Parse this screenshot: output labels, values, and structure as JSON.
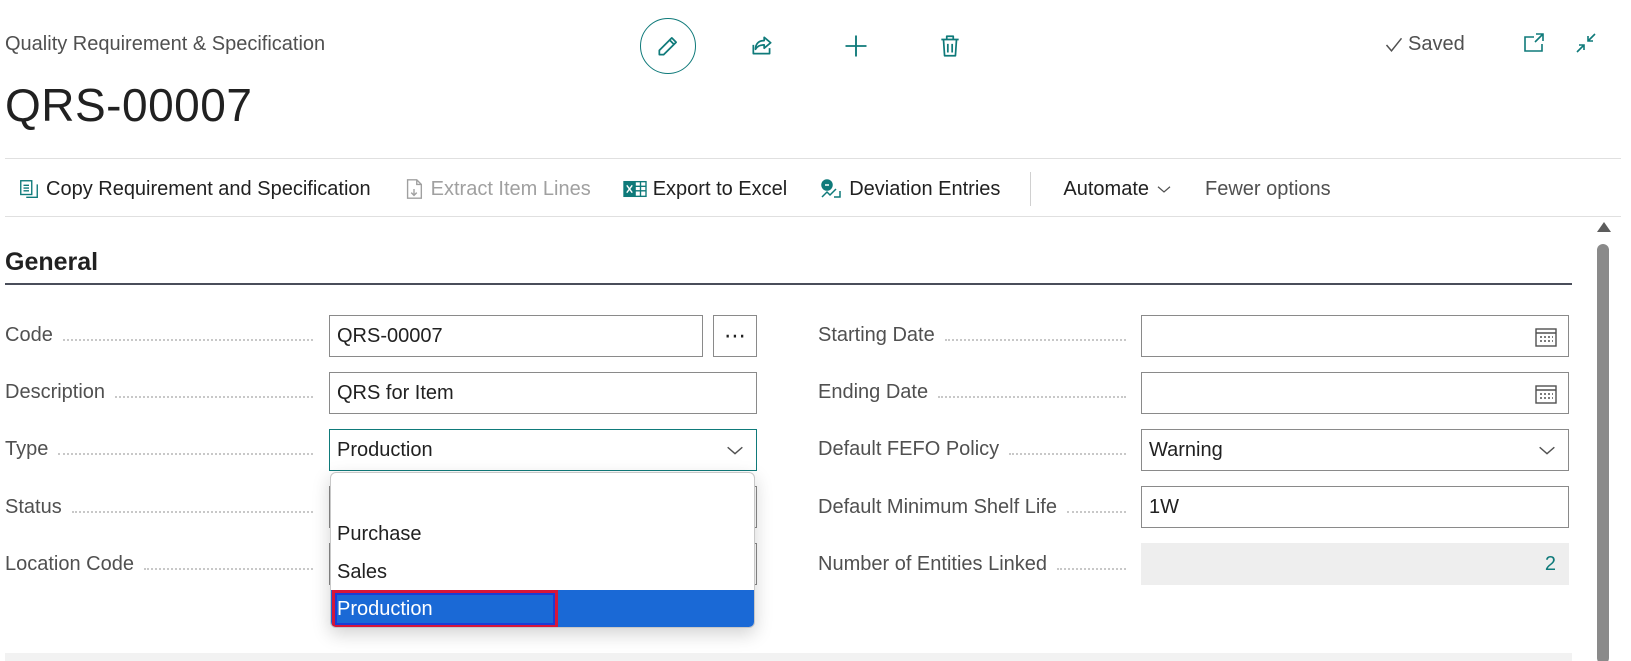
{
  "header": {
    "caption": "Quality Requirement & Specification",
    "title": "QRS-00007",
    "saved_label": "Saved"
  },
  "toolbar": {
    "copy_label": "Copy Requirement and Specification",
    "extract_label": "Extract Item Lines",
    "export_label": "Export to Excel",
    "deviation_label": "Deviation Entries",
    "automate_label": "Automate",
    "fewer_label": "Fewer options"
  },
  "section": {
    "title": "General"
  },
  "fields": {
    "code": {
      "label": "Code",
      "value": "QRS-00007"
    },
    "description": {
      "label": "Description",
      "value": "QRS for Item"
    },
    "type": {
      "label": "Type",
      "value": "Production"
    },
    "status": {
      "label": "Status"
    },
    "location_code": {
      "label": "Location Code"
    },
    "starting_date": {
      "label": "Starting Date",
      "value": ""
    },
    "ending_date": {
      "label": "Ending Date",
      "value": ""
    },
    "fefo_policy": {
      "label": "Default FEFO Policy",
      "value": "Warning"
    },
    "min_shelf_life": {
      "label": "Default Minimum Shelf Life",
      "value": "1W"
    },
    "entities_linked": {
      "label": "Number of Entities Linked",
      "value": "2"
    }
  },
  "type_dropdown": {
    "options": [
      "",
      "Purchase",
      "Sales",
      "Production"
    ],
    "selected": "Production"
  },
  "colors": {
    "accent": "#0f7a7a",
    "selection": "#1a69d6",
    "highlight_border": "#d6163a"
  },
  "icons": [
    "edit-icon",
    "share-icon",
    "add-icon",
    "delete-icon",
    "checkmark-icon",
    "open-new-window-icon",
    "collapse-icon",
    "copy-doc-icon",
    "extract-doc-icon",
    "excel-icon",
    "deviation-icon",
    "chevron-down-icon",
    "ellipsis-icon",
    "calendar-icon"
  ]
}
